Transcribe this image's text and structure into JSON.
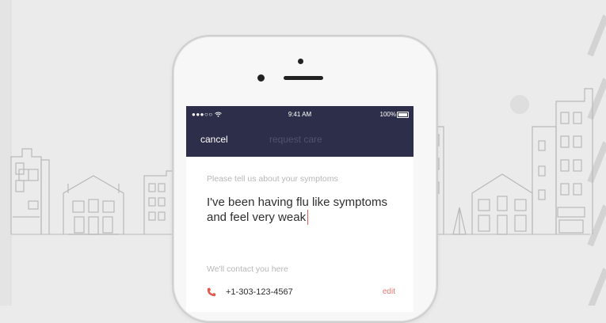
{
  "status_bar": {
    "signal": "●●●○○",
    "time": "9:41 AM",
    "battery": "100%"
  },
  "nav": {
    "cancel_label": "cancel",
    "title": "request care"
  },
  "form": {
    "symptoms_label": "Please tell us about your symptoms",
    "symptoms_value": "I've been having flu like symptoms and feel very weak",
    "contact_label": "We'll contact you here",
    "phone_number": "+1-303-123-4567",
    "edit_label": "edit"
  },
  "colors": {
    "nav_background": "#2d2f4a",
    "nav_title": "#4f5270",
    "accent": "#e05a4f",
    "background": "#ebebeb"
  },
  "icons": {
    "wifi": "wifi-icon",
    "battery": "battery-icon",
    "phone": "phone-icon"
  }
}
